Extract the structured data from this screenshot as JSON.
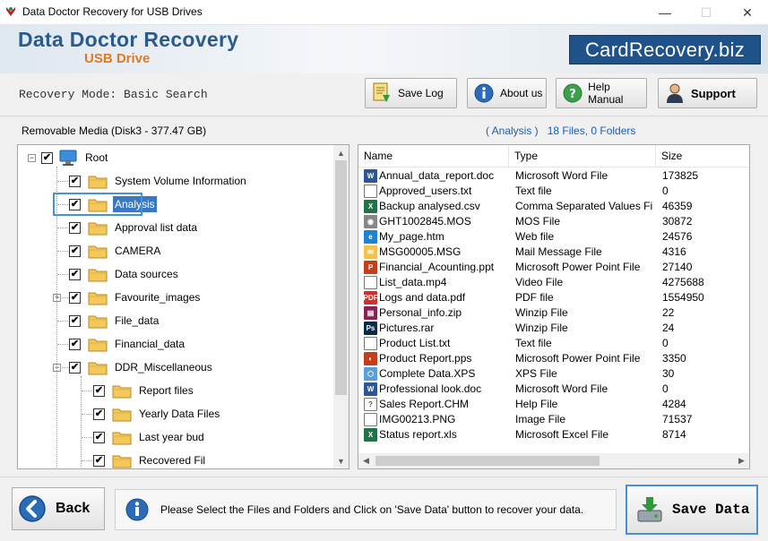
{
  "window": {
    "title": "Data Doctor Recovery for USB Drives",
    "minimize": "—",
    "maximize": "☐",
    "close": "✕"
  },
  "banner": {
    "title": "Data Doctor Recovery",
    "subtitle": "USB Drive",
    "site": "CardRecovery.biz"
  },
  "toolbar": {
    "mode_label": "Recovery Mode: Basic Search",
    "save_log": "Save Log",
    "about_us": "About us",
    "help_manual": "Help Manual",
    "support": "Support"
  },
  "media": {
    "label": "Removable Media (Disk3 - 377.47 GB)"
  },
  "analysis": {
    "folder": "( Analysis )",
    "files": "18 Files, 0 Folders"
  },
  "tree": {
    "root": "Root",
    "items": [
      "System Volume Information",
      "Analysis",
      "Approval list data",
      "CAMERA",
      "Data sources",
      "Favourite_images",
      "File_data",
      "Financial_data",
      "DDR_Miscellaneous",
      "Report files",
      "Yearly Data Files",
      "Last year bud",
      "Recovered Fil"
    ]
  },
  "list": {
    "headers": [
      "Name",
      "Type",
      "Size"
    ],
    "rows": [
      {
        "name": "Annual_data_report.doc",
        "type": "Microsoft Word File",
        "size": "173825",
        "icon": "word-icon",
        "color": "#2b579a",
        "glyph": "W"
      },
      {
        "name": "Approved_users.txt",
        "type": "Text file",
        "size": "0",
        "icon": "text-file-icon",
        "color": "#ffffff",
        "glyph": ""
      },
      {
        "name": "Backup analysed.csv",
        "type": "Comma Separated Values File",
        "size": "46359",
        "icon": "excel-icon",
        "color": "#217346",
        "glyph": "X"
      },
      {
        "name": "GHT1002845.MOS",
        "type": "MOS File",
        "size": "30872",
        "icon": "mos-file-icon",
        "color": "#888888",
        "glyph": "◉"
      },
      {
        "name": "My_page.htm",
        "type": "Web file",
        "size": "24576",
        "icon": "edge-icon",
        "color": "#1b83d4",
        "glyph": "e"
      },
      {
        "name": "MSG00005.MSG",
        "type": "Mail Message File",
        "size": "4316",
        "icon": "mail-icon",
        "color": "#f2c14e",
        "glyph": "✉"
      },
      {
        "name": "Financial_Acounting.ppt",
        "type": "Microsoft Power Point File",
        "size": "27140",
        "icon": "powerpoint-icon",
        "color": "#c43e1c",
        "glyph": "P"
      },
      {
        "name": "List_data.mp4",
        "type": "Video File",
        "size": "4275688",
        "icon": "video-file-icon",
        "color": "#ffffff",
        "glyph": ""
      },
      {
        "name": "Logs and data.pdf",
        "type": "PDF file",
        "size": "1554950",
        "icon": "pdf-icon",
        "color": "#d0312d",
        "glyph": "PDF"
      },
      {
        "name": "Personal_info.zip",
        "type": "Winzip File",
        "size": "22",
        "icon": "winrar-icon",
        "color": "#8b2252",
        "glyph": "▤"
      },
      {
        "name": "Pictures.rar",
        "type": "Winzip File",
        "size": "24",
        "icon": "photoshop-icon",
        "color": "#0a2a4a",
        "glyph": "Ps"
      },
      {
        "name": "Product List.txt",
        "type": "Text file",
        "size": "0",
        "icon": "text-file-icon",
        "color": "#ffffff",
        "glyph": ""
      },
      {
        "name": "Product Report.pps",
        "type": "Microsoft Power Point File",
        "size": "3350",
        "icon": "pps-icon",
        "color": "#c43e1c",
        "glyph": "◐"
      },
      {
        "name": "Complete Data.XPS",
        "type": "XPS File",
        "size": "30",
        "icon": "xps-icon",
        "color": "#5aa0d8",
        "glyph": "⬡"
      },
      {
        "name": "Professional look.doc",
        "type": "Microsoft Word File",
        "size": "0",
        "icon": "word-icon",
        "color": "#2b579a",
        "glyph": "W"
      },
      {
        "name": "Sales Report.CHM",
        "type": "Help File",
        "size": "4284",
        "icon": "help-file-icon",
        "color": "#ffffff",
        "glyph": "?"
      },
      {
        "name": "IMG00213.PNG",
        "type": "Image File",
        "size": "71537",
        "icon": "image-file-icon",
        "color": "#ffffff",
        "glyph": ""
      },
      {
        "name": "Status report.xls",
        "type": "Microsoft Excel File",
        "size": "8714",
        "icon": "excel-icon",
        "color": "#217346",
        "glyph": "X"
      }
    ]
  },
  "footer": {
    "back": "Back",
    "message": "Please Select the Files and Folders and Click on 'Save Data' button to recover your data.",
    "save_data": "Save Data"
  }
}
